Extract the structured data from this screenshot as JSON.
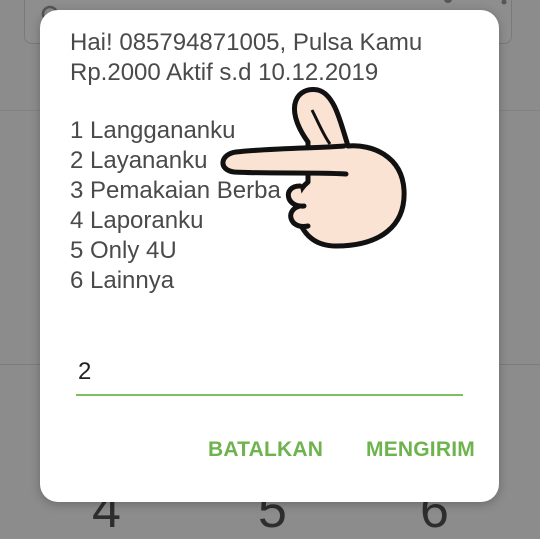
{
  "dialog": {
    "message": "Hai! 085794871005, Pulsa Kamu\nRp.2000 Aktif s.d 10.12.2019",
    "menu": [
      "1 Langgananku",
      "2 Layananku",
      "3 Pemakaian Berba",
      "4 Laporanku",
      "5 Only 4U",
      "6 Lainnya"
    ],
    "input_value": "2",
    "cancel_label": "BATALKAN",
    "send_label": "MENGIRIM"
  },
  "background": {
    "keys": [
      "4",
      "5",
      "6"
    ]
  },
  "colors": {
    "accent": "#6fb34e",
    "underline": "#7cbf5e",
    "text": "#4a4a4a",
    "scrim": "#8c8c8c"
  },
  "icons": {
    "pointer": "pointing-hand-icon",
    "search": "search-icon",
    "mic": "mic-icon",
    "more": "more-vert-icon"
  }
}
